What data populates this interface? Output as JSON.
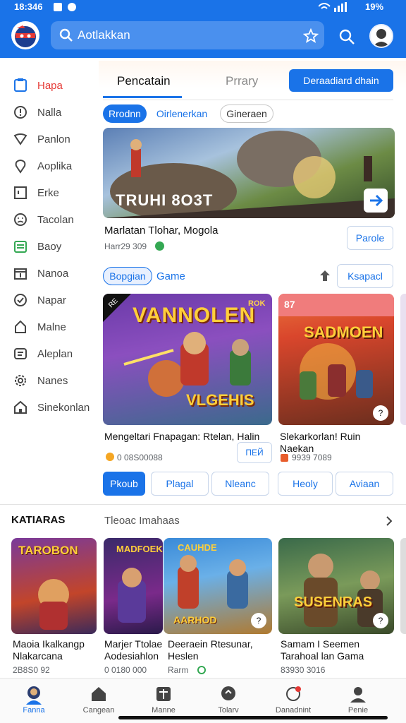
{
  "status": {
    "time": "18:346",
    "battery": "19%"
  },
  "search": {
    "query": "Aotlakkan"
  },
  "sidebar": {
    "items": [
      {
        "label": "Hapa",
        "icon": "home-icon",
        "active": true
      },
      {
        "label": "Nalla",
        "icon": "alert-icon"
      },
      {
        "label": "Panlon",
        "icon": "tag-icon"
      },
      {
        "label": "Aoplika",
        "icon": "location-icon"
      },
      {
        "label": "Erke",
        "icon": "frame-icon"
      },
      {
        "label": "Tacolan",
        "icon": "face-icon"
      },
      {
        "label": "Baoy",
        "icon": "book-icon"
      },
      {
        "label": "Nanoa",
        "icon": "calendar-icon"
      },
      {
        "label": "Napar",
        "icon": "check-icon"
      },
      {
        "label": "Malne",
        "icon": "person-icon"
      },
      {
        "label": "Aleplan",
        "icon": "grid-icon"
      },
      {
        "label": "Nanes",
        "icon": "gear-icon"
      },
      {
        "label": "Sinekonlan",
        "icon": "house-icon"
      }
    ]
  },
  "top_tabs": {
    "tab1": "Pencatain",
    "tab2": "Prrary",
    "cta": "Deraadiard dhain"
  },
  "filters": {
    "f1": "Rrodnn",
    "f2": "Oirlenerkan",
    "f3": "Gineraen"
  },
  "hero": {
    "banner_text": "TRUHI 8O3T",
    "title": "Marlatan Tlohar, Mogola",
    "meta": "Harr29 309",
    "action": "Parole"
  },
  "game_section": {
    "chip": "Bopgian",
    "label": "Game",
    "more": "Ksapacl"
  },
  "games": [
    {
      "art_title": "VANNOLEN",
      "art_sub": "VLGEHIS",
      "badge_left": "RE",
      "badge_right": "ROK",
      "title": "Mengeltari Fnapagan: Rtelan, Halin",
      "meta": "0 08S00088",
      "action": "ПЕЙ"
    },
    {
      "art_title": "SADMOEN",
      "badge_left": "87",
      "title": "Slekarkorlan! Ruin Naekan",
      "meta": "9939 7089"
    }
  ],
  "buttons": {
    "b1": "Pkoub",
    "b2": "Plagal",
    "b3": "Nleanc",
    "b4": "Heoly",
    "b5": "Aviaan"
  },
  "section2": {
    "heading": "KATIARAS",
    "subtitle": "Tleoac Imahaas"
  },
  "cards": [
    {
      "art": "TAROBON",
      "title": "Maoia Ikalkangp Nlakarcana",
      "meta": "2B8S0 92"
    },
    {
      "art": "MADFOEK",
      "title": "Marjer Ttolae Aodesiahlon",
      "meta": "0 0180 000"
    },
    {
      "art": "CAUHDE",
      "art2": "AARHOD",
      "title": "Deeraein Rtesunar, Heslen",
      "meta": "Rarm"
    },
    {
      "art": "SUSENRAS",
      "title": "Samam I Seemen Tarahoal lan Gama",
      "meta": "83930 3016"
    }
  ],
  "bottom_nav": [
    {
      "label": "Fanna"
    },
    {
      "label": "Cangean"
    },
    {
      "label": "Manne"
    },
    {
      "label": "Tolarv"
    },
    {
      "label": "Danadnint"
    },
    {
      "label": "Penie"
    }
  ],
  "colors": {
    "primary": "#1a73e8",
    "green": "#34a853",
    "orange": "#f5a623"
  }
}
